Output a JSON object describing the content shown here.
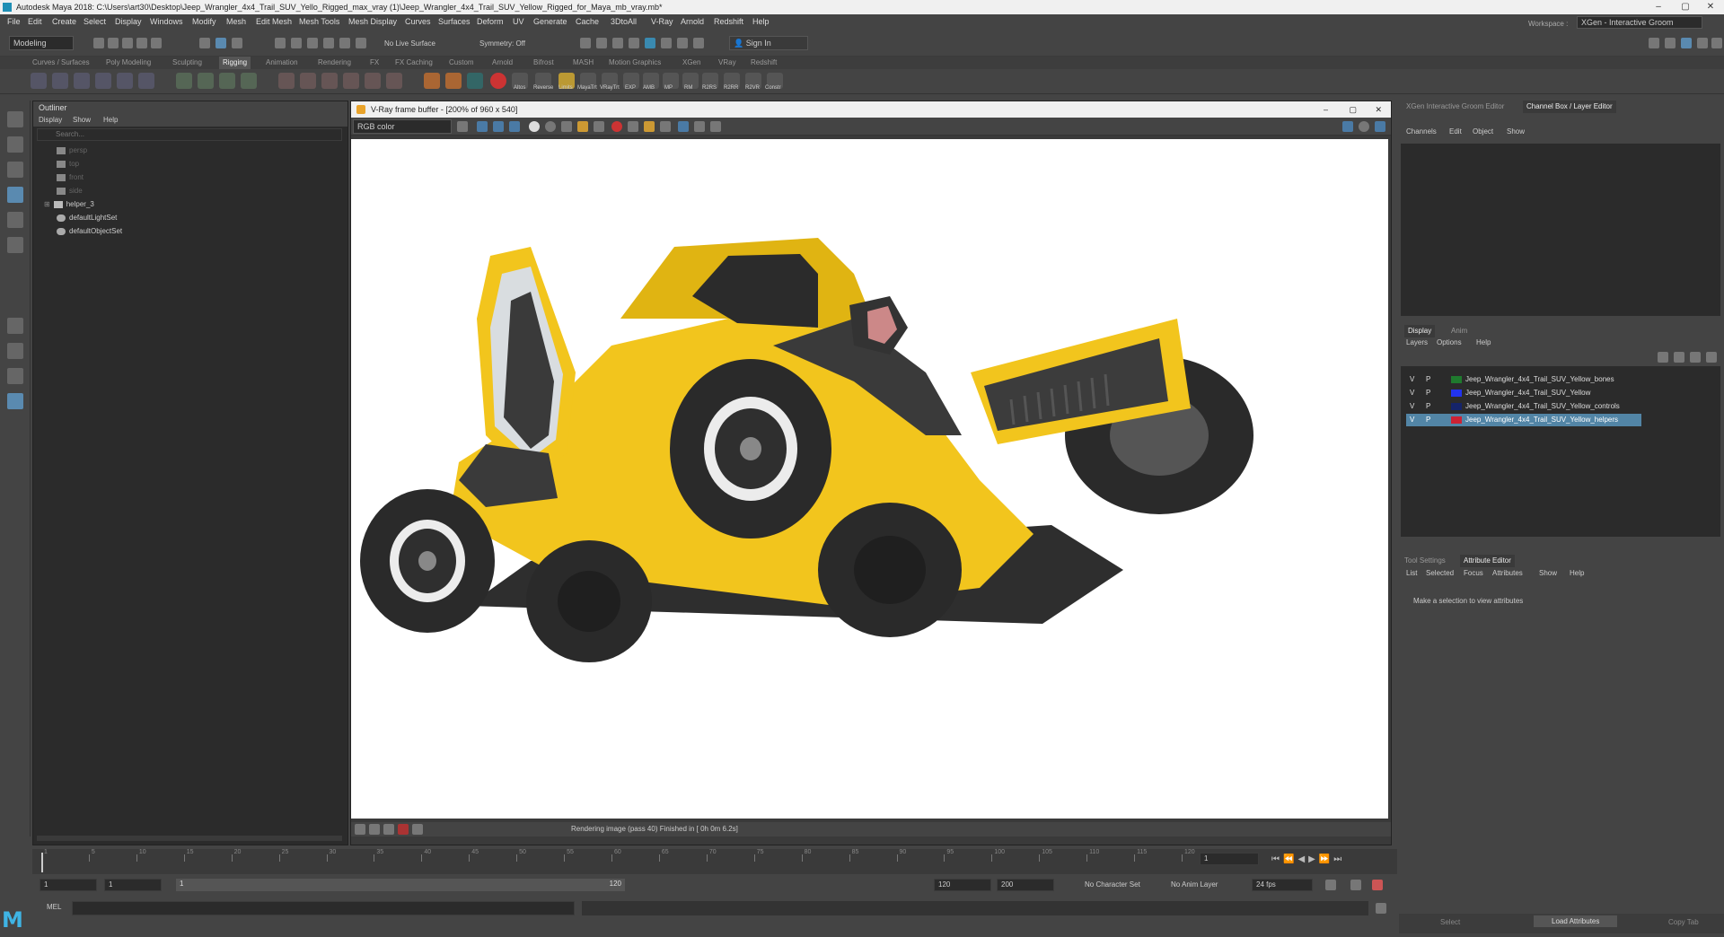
{
  "window": {
    "title": "Autodesk Maya 2018: C:\\Users\\art30\\Desktop\\Jeep_Wrangler_4x4_Trail_SUV_Yello_Rigged_max_vray (1)\\Jeep_Wrangler_4x4_Trail_SUV_Yellow_Rigged_for_Maya_mb_vray.mb*"
  },
  "menus": [
    "File",
    "Edit",
    "Create",
    "Select",
    "Display",
    "Windows",
    "Modify",
    "Mesh",
    "Edit Mesh",
    "Mesh Tools",
    "Mesh Display",
    "Curves",
    "Surfaces",
    "Deform",
    "UV",
    "Generate",
    "Cache",
    "3DtoAll",
    "V-Ray",
    "Arnold",
    "Redshift",
    "Help"
  ],
  "status": {
    "mode": "Modeling",
    "live_surface": "No Live Surface",
    "symmetry": "Symmetry: Off",
    "sign_in": "Sign In",
    "workspace_label": "Workspace :",
    "workspace": "XGen - Interactive Groom"
  },
  "shelf_tabs": [
    "Curves / Surfaces",
    "Poly Modeling",
    "Sculpting",
    "Rigging",
    "Animation",
    "Rendering",
    "FX",
    "FX Caching",
    "Custom",
    "Arnold",
    "Bifrost",
    "MASH",
    "Motion Graphics",
    "XGen",
    "VRay",
    "Redshift"
  ],
  "shelf_labels": [
    "Altos",
    "Reverse",
    "Limits",
    "MayaTrt",
    "VRayTrt",
    "EXP",
    "AMB",
    "MP",
    "RM",
    "R2RS",
    "R2RR",
    "R2VR",
    "Constr"
  ],
  "outliner": {
    "title": "Outliner",
    "menu": [
      "Display",
      "Show",
      "Help"
    ],
    "search_placeholder": "Search...",
    "items": [
      "persp",
      "top",
      "front",
      "side",
      "helper_3",
      "defaultLightSet",
      "defaultObjectSet"
    ]
  },
  "vfb": {
    "title": "V-Ray frame buffer - [200% of 960 x 540]",
    "channel": "RGB color",
    "status": "Rendering image (pass 40) Finished in [ 0h  0m  6.2s]"
  },
  "right_panel": {
    "tabs_top": [
      "XGen Interactive Groom Editor",
      "Channel Box / Layer Editor"
    ],
    "channel_menu": [
      "Channels",
      "Edit",
      "Object",
      "Show"
    ],
    "layer_tabs": [
      "Display",
      "Anim"
    ],
    "layer_menu": [
      "Layers",
      "Options",
      "Help"
    ],
    "layers": [
      {
        "v": "V",
        "p": "P",
        "name": "Jeep_Wrangler_4x4_Trail_SUV_Yellow_bones",
        "color": "#1f7a2e"
      },
      {
        "v": "V",
        "p": "P",
        "name": "Jeep_Wrangler_4x4_Trail_SUV_Yellow",
        "color": "#2233ee"
      },
      {
        "v": "V",
        "p": "P",
        "name": "Jeep_Wrangler_4x4_Trail_SUV_Yellow_controls",
        "color": "#15246a"
      },
      {
        "v": "V",
        "p": "P",
        "name": "Jeep_Wrangler_4x4_Trail_SUV_Yellow_helpers",
        "color": "#cc2233"
      }
    ],
    "attr_tabs": [
      "Tool Settings",
      "Attribute Editor"
    ],
    "attr_menu": [
      "List",
      "Selected",
      "Focus",
      "Attributes",
      "Show",
      "Help"
    ],
    "attr_msg": "Make a selection to view attributes",
    "buttons": [
      "Select",
      "Load Attributes",
      "Copy Tab"
    ]
  },
  "timeline": {
    "ticks": [
      "1",
      "5",
      "10",
      "15",
      "20",
      "25",
      "30",
      "35",
      "40",
      "45",
      "50",
      "55",
      "60",
      "65",
      "70",
      "75",
      "80",
      "85",
      "90",
      "95",
      "100",
      "105",
      "110",
      "115",
      "120"
    ],
    "current_frame": "1"
  },
  "range": {
    "start": "1",
    "start2": "1",
    "slider_start": "1",
    "slider_end": "120",
    "end": "120",
    "end2": "200",
    "character": "No Character Set",
    "anim_layer": "No Anim Layer",
    "fps": "24 fps"
  },
  "mel": {
    "label": "MEL"
  },
  "logo": "M"
}
